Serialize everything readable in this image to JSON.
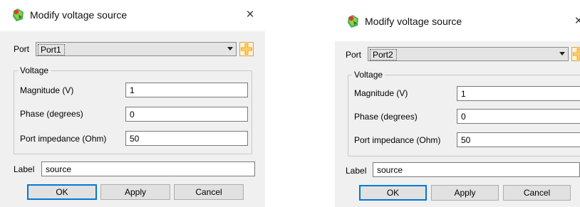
{
  "dialogs": [
    {
      "title": "Modify voltage source",
      "close_glyph": "×",
      "port_label": "Port",
      "port_value": "Port1",
      "group_title": "Voltage",
      "magnitude_label": "Magnitude (V)",
      "magnitude_value": "1",
      "phase_label": "Phase (degrees)",
      "phase_value": "0",
      "impedance_label": "Port impedance (Ohm)",
      "impedance_value": "50",
      "label_label": "Label",
      "label_value": "source",
      "ok_label": "OK",
      "apply_label": "Apply",
      "cancel_label": "Cancel"
    },
    {
      "title": "Modify voltage source",
      "close_glyph": "×",
      "port_label": "Port",
      "port_value": "Port2",
      "group_title": "Voltage",
      "magnitude_label": "Magnitude (V)",
      "magnitude_value": "1",
      "phase_label": "Phase (degrees)",
      "phase_value": "0",
      "impedance_label": "Port impedance (Ohm)",
      "impedance_value": "50",
      "label_label": "Label",
      "label_value": "source",
      "ok_label": "OK",
      "apply_label": "Apply",
      "cancel_label": "Cancel"
    }
  ],
  "icons": {
    "app": "voltage-source-app-icon",
    "close": "close-icon",
    "dropdown": "chevron-down-icon",
    "add_port": "add-port-icon"
  },
  "colors": {
    "dialog_bg": "#f0f0f0",
    "titlebar_bg": "#ffffff",
    "default_button_border": "#0078d7",
    "add_icon_orange": "#f4a21e"
  }
}
